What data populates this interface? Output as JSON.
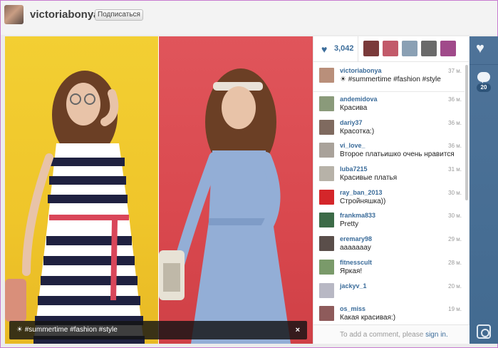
{
  "header": {
    "username": "victoriabonya",
    "follow_label": "Подписаться"
  },
  "photo": {
    "caption": "☀ #summertime #fashion #style",
    "close_label": "×"
  },
  "likes": {
    "count": "3,042"
  },
  "comments": [
    {
      "user": "victoriabonya",
      "time": "37 м.",
      "text": "☀ #summertime #fashion #style",
      "color": "#b98f7a"
    },
    {
      "user": "andemidova",
      "time": "36 м.",
      "text": "Красива",
      "color": "#8a9a7a"
    },
    {
      "user": "dariy37",
      "time": "36 м.",
      "text": "Красотка:)",
      "color": "#7f6a5f"
    },
    {
      "user": "vi_love_",
      "time": "36 м.",
      "text": "Второе платьишко очень нравится",
      "color": "#a9a29a"
    },
    {
      "user": "luba7215",
      "time": "31 м.",
      "text": "Красивые платья",
      "color": "#b7b2a8"
    },
    {
      "user": "ray_ban_2013",
      "time": "30 м.",
      "text": "Стройняшка))",
      "color": "#d4262a"
    },
    {
      "user": "frankma833",
      "time": "30 м.",
      "text": "Pretty",
      "color": "#3c6b47"
    },
    {
      "user": "eremary98",
      "time": "29 м.",
      "text": "ааааааау",
      "color": "#5a4e4a"
    },
    {
      "user": "fitnesscult",
      "time": "28 м.",
      "text": "Яркая!",
      "color": "#7a9a6a"
    },
    {
      "user": "jackyv_1",
      "time": "20 м.",
      "text": "",
      "color": "#b8b8c4"
    },
    {
      "user": "os_miss",
      "time": "19 м.",
      "text": "Какая красивая:)",
      "color": "#8e5b5b"
    }
  ],
  "add_comment": {
    "prompt": "To add a comment, please",
    "link": "sign in."
  },
  "rail": {
    "comment_count": "20"
  },
  "likers": [
    "#7a3a3a",
    "#c25a6a",
    "#8aa0b4",
    "#6a6a6a",
    "#a04a8a"
  ]
}
